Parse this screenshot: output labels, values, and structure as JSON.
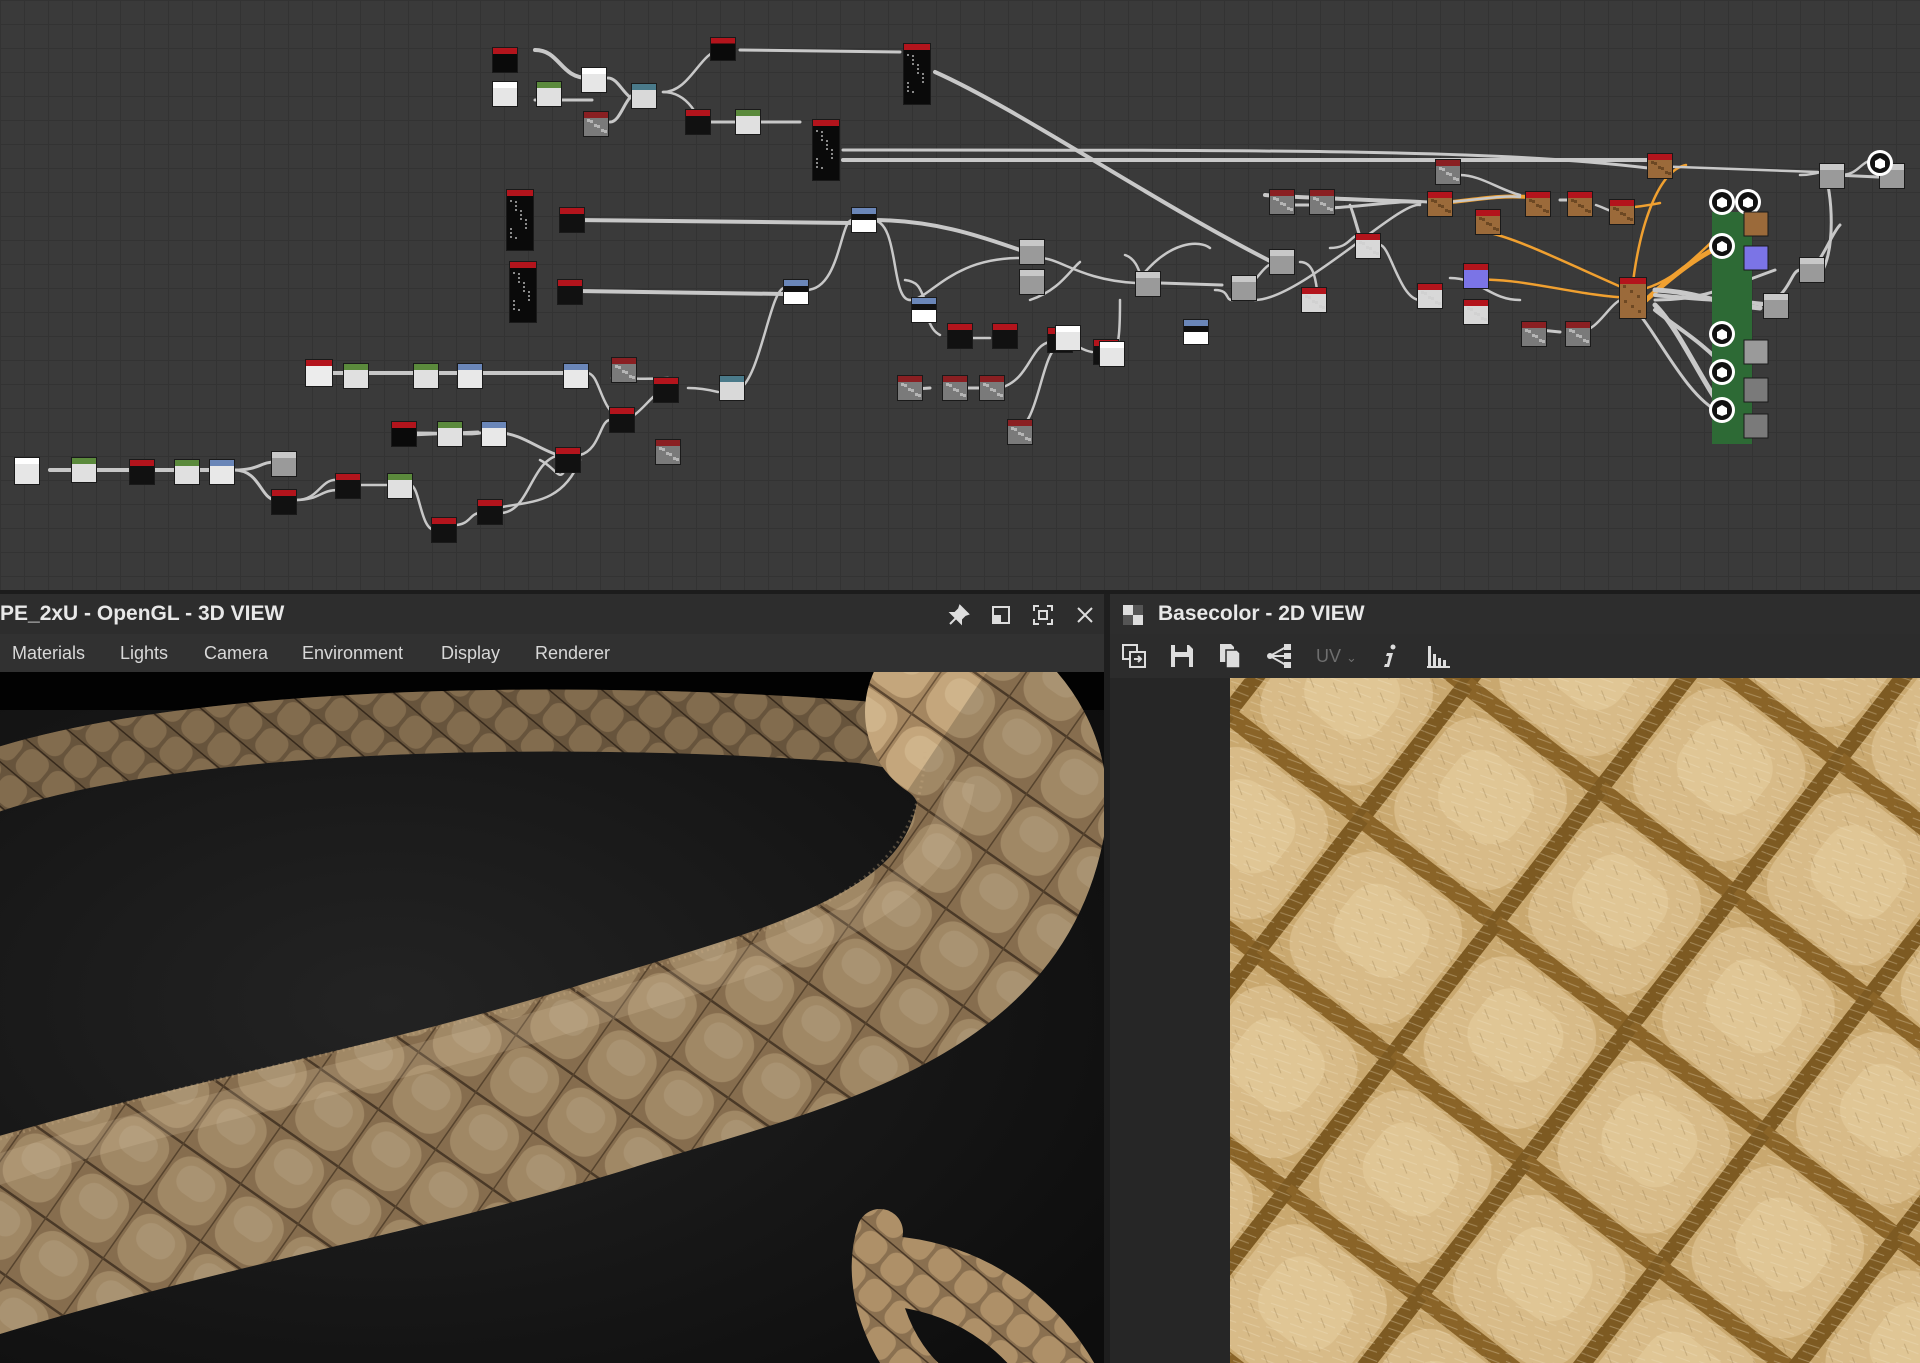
{
  "graph": {
    "label": "Node graph",
    "colors": {
      "background": "#3a3a3a",
      "node_red": "#b3141c",
      "wire_white": "#c8c8c8",
      "wire_orange": "#f0a030",
      "output_panel": "#2d6a35"
    }
  },
  "panel3d": {
    "title": "PE_2xU - OpenGL - 3D VIEW",
    "icons": [
      "pin-icon",
      "float-window-icon",
      "maximize-icon",
      "close-icon"
    ],
    "menu": [
      "Materials",
      "Lights",
      "Camera",
      "Environment",
      "Display",
      "Renderer"
    ]
  },
  "panel2d": {
    "title": "Basecolor - 2D VIEW",
    "icons": [
      "checker-icon",
      "export-view-icon",
      "save-icon",
      "copy-icon",
      "share-icon",
      "info-icon",
      "histogram-icon"
    ],
    "uv_label": "UV"
  },
  "colors": {
    "rope_light": "#c9ac80",
    "rope_mid": "#a48660",
    "rope_dark": "#5b4630",
    "texture_light": "#dcc090",
    "texture_groove": "#8a6428"
  }
}
